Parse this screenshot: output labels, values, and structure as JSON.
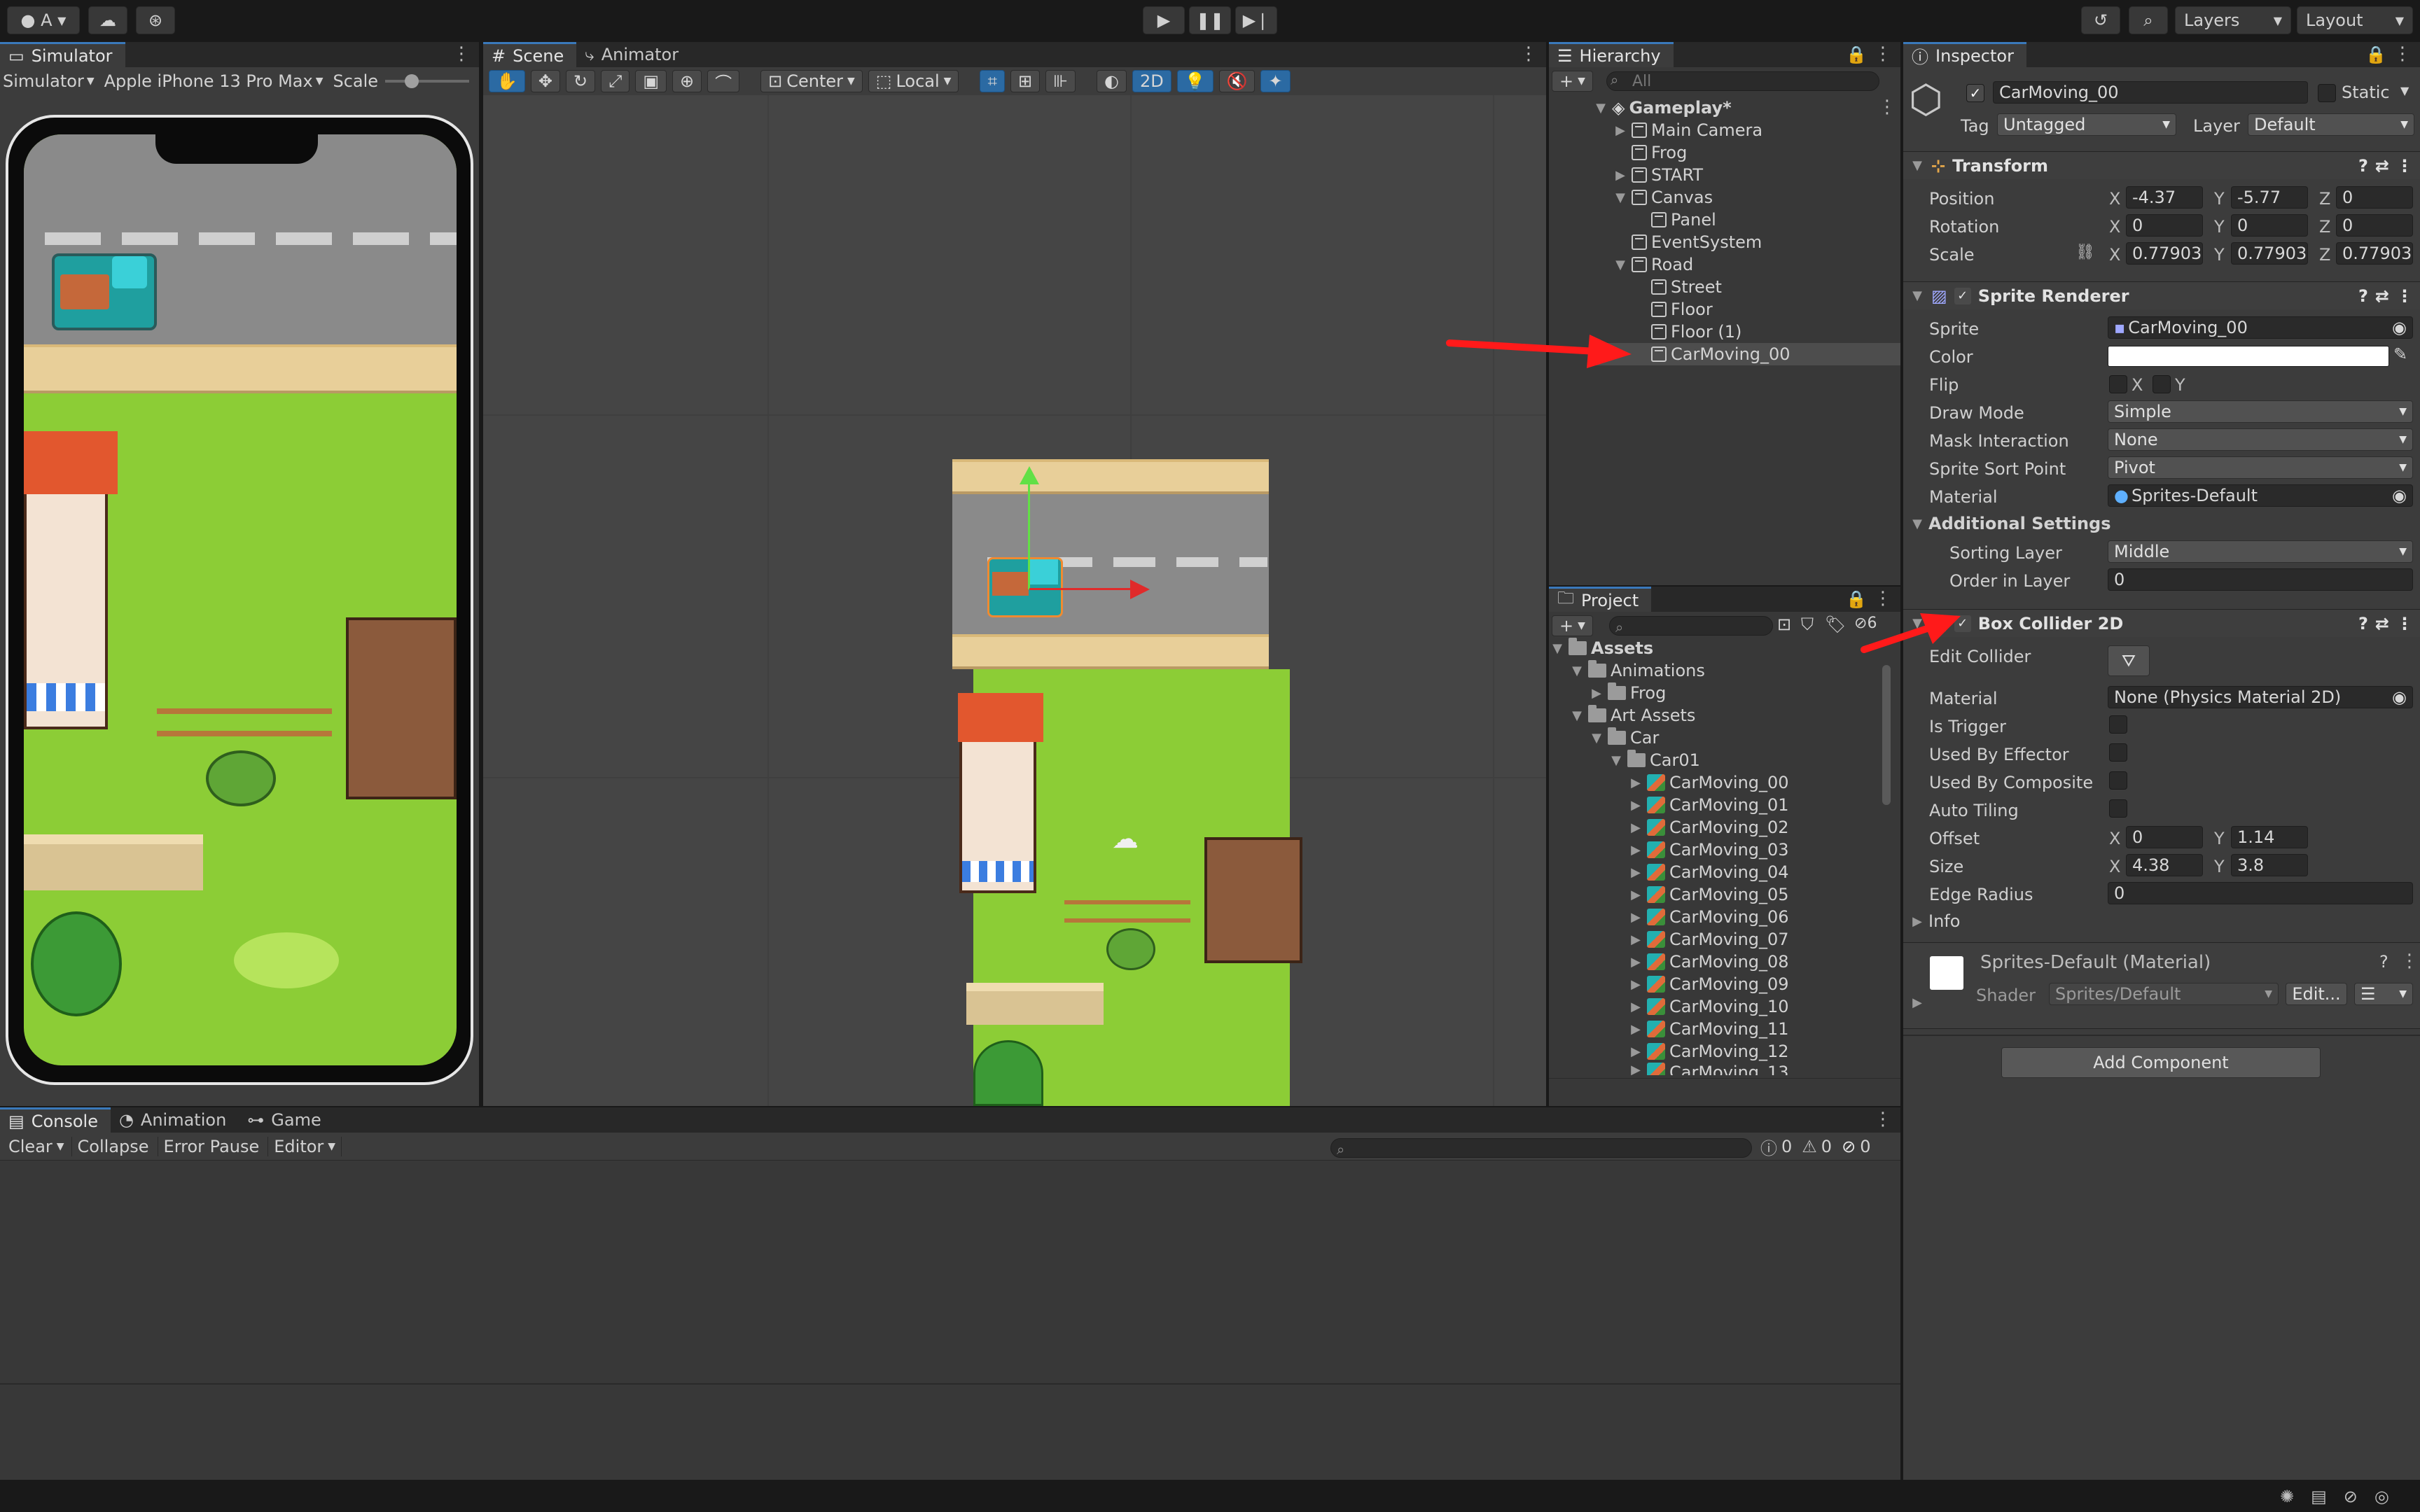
{
  "topbar": {
    "account": "A",
    "layers": "Layers",
    "layout": "Layout"
  },
  "simulator": {
    "tab": "Simulator",
    "mode": "Simulator",
    "device": "Apple iPhone 13 Pro Max",
    "scale": "Scale"
  },
  "scene": {
    "tab_scene": "Scene",
    "tab_animator": "Animator",
    "pivot": "Center",
    "space": "Local",
    "mode2d": "2D"
  },
  "hierarchy": {
    "tab": "Hierarchy",
    "search_placeholder": "All",
    "scene_name": "Gameplay*",
    "items": [
      {
        "label": "Main Camera"
      },
      {
        "label": "Frog"
      },
      {
        "label": "START"
      },
      {
        "label": "Canvas"
      },
      {
        "label": "Panel"
      },
      {
        "label": "EventSystem"
      },
      {
        "label": "Road"
      },
      {
        "label": "Street"
      },
      {
        "label": "Floor"
      },
      {
        "label": "Floor (1)"
      },
      {
        "label": "CarMoving_00"
      }
    ]
  },
  "project": {
    "tab": "Project",
    "hidden_count": "6",
    "tree": [
      {
        "label": "Assets"
      },
      {
        "label": "Animations"
      },
      {
        "label": "Frog"
      },
      {
        "label": "Art Assets"
      },
      {
        "label": "Car"
      },
      {
        "label": "Car01"
      },
      {
        "label": "CarMoving_00"
      },
      {
        "label": "CarMoving_01"
      },
      {
        "label": "CarMoving_02"
      },
      {
        "label": "CarMoving_03"
      },
      {
        "label": "CarMoving_04"
      },
      {
        "label": "CarMoving_05"
      },
      {
        "label": "CarMoving_06"
      },
      {
        "label": "CarMoving_07"
      },
      {
        "label": "CarMoving_08"
      },
      {
        "label": "CarMoving_09"
      },
      {
        "label": "CarMoving_10"
      },
      {
        "label": "CarMoving_11"
      },
      {
        "label": "CarMoving_12"
      },
      {
        "label": "CarMoving_13"
      }
    ]
  },
  "inspector": {
    "tab": "Inspector",
    "object_name": "CarMoving_00",
    "static_label": "Static",
    "tag_label": "Tag",
    "tag_value": "Untagged",
    "layer_label": "Layer",
    "layer_value": "Default",
    "transform": {
      "title": "Transform",
      "position_label": "Position",
      "rotation_label": "Rotation",
      "scale_label": "Scale",
      "x": "X",
      "y": "Y",
      "z": "Z",
      "position": {
        "x": "-4.37",
        "y": "-5.77",
        "z": "0"
      },
      "rotation": {
        "x": "0",
        "y": "0",
        "z": "0"
      },
      "scale": {
        "x": "0.77903",
        "y": "0.77903",
        "z": "0.77903"
      }
    },
    "sprite_renderer": {
      "title": "Sprite Renderer",
      "sprite_label": "Sprite",
      "sprite_value": "CarMoving_00",
      "color_label": "Color",
      "flip_label": "Flip",
      "flip_x": "X",
      "flip_y": "Y",
      "draw_mode_label": "Draw Mode",
      "draw_mode_value": "Simple",
      "mask_label": "Mask Interaction",
      "mask_value": "None",
      "sort_point_label": "Sprite Sort Point",
      "sort_point_value": "Pivot",
      "material_label": "Material",
      "material_value": "Sprites-Default",
      "additional_label": "Additional Settings",
      "sorting_layer_label": "Sorting Layer",
      "sorting_layer_value": "Middle",
      "order_label": "Order in Layer",
      "order_value": "0"
    },
    "box_collider": {
      "title": "Box Collider 2D",
      "edit_label": "Edit Collider",
      "material_label": "Material",
      "material_value": "None (Physics Material 2D)",
      "trigger_label": "Is Trigger",
      "effector_label": "Used By Effector",
      "composite_label": "Used By Composite",
      "tiling_label": "Auto Tiling",
      "offset_label": "Offset",
      "offset": {
        "x": "0",
        "y": "1.14"
      },
      "size_label": "Size",
      "size": {
        "x": "4.38",
        "y": "3.8"
      },
      "edge_label": "Edge Radius",
      "edge_value": "0",
      "info_label": "Info"
    },
    "material_block": {
      "title": "Sprites-Default (Material)",
      "shader_label": "Shader",
      "shader_value": "Sprites/Default",
      "edit_label": "Edit..."
    },
    "add_component": "Add Component"
  },
  "console": {
    "tab_console": "Console",
    "tab_animation": "Animation",
    "tab_game": "Game",
    "clear": "Clear",
    "collapse": "Collapse",
    "error_pause": "Error Pause",
    "editor": "Editor",
    "count_log": "0",
    "count_warn": "0",
    "count_err": "0"
  },
  "colors": {
    "accent": "#3a79bb",
    "annotation_arrow": "#ff1a1a",
    "grass": "#8ccd36",
    "road": "#8a8a8a"
  }
}
